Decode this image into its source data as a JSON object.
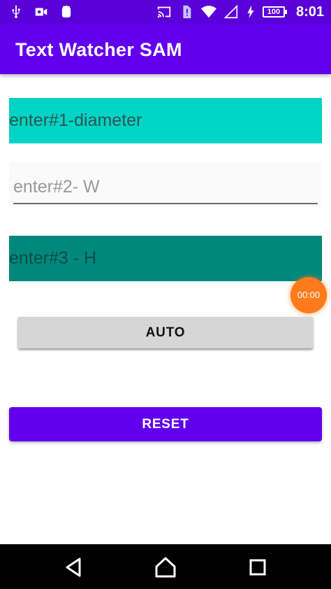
{
  "status_bar": {
    "time": "8:01",
    "battery": "100",
    "icons": [
      "usb-icon",
      "video-camera-icon",
      "android-debug-icon",
      "cast-icon",
      "sim-alert-icon",
      "wifi-icon",
      "signal-icon",
      "battery-charging-icon"
    ]
  },
  "app_bar": {
    "title": "Text Watcher SAM"
  },
  "fields": {
    "diameter": {
      "placeholder": "enter#1-diameter",
      "value": ""
    },
    "width": {
      "placeholder": "enter#2- W",
      "value": ""
    },
    "height": {
      "placeholder": "enter#3 - H",
      "value": ""
    }
  },
  "timer": {
    "label": "00:00"
  },
  "buttons": {
    "auto": "AUTO",
    "reset": "RESET"
  },
  "nav_bar": {
    "icons": [
      "back-icon",
      "home-icon",
      "recents-icon"
    ]
  },
  "colors": {
    "status_bar": "#5a00d8",
    "app_bar": "#6200ee",
    "field1": "#00d4c4",
    "field3": "#00887c",
    "timer": "#ff7a1a",
    "reset_button": "#6200ee",
    "auto_button": "#d6d6d6"
  }
}
